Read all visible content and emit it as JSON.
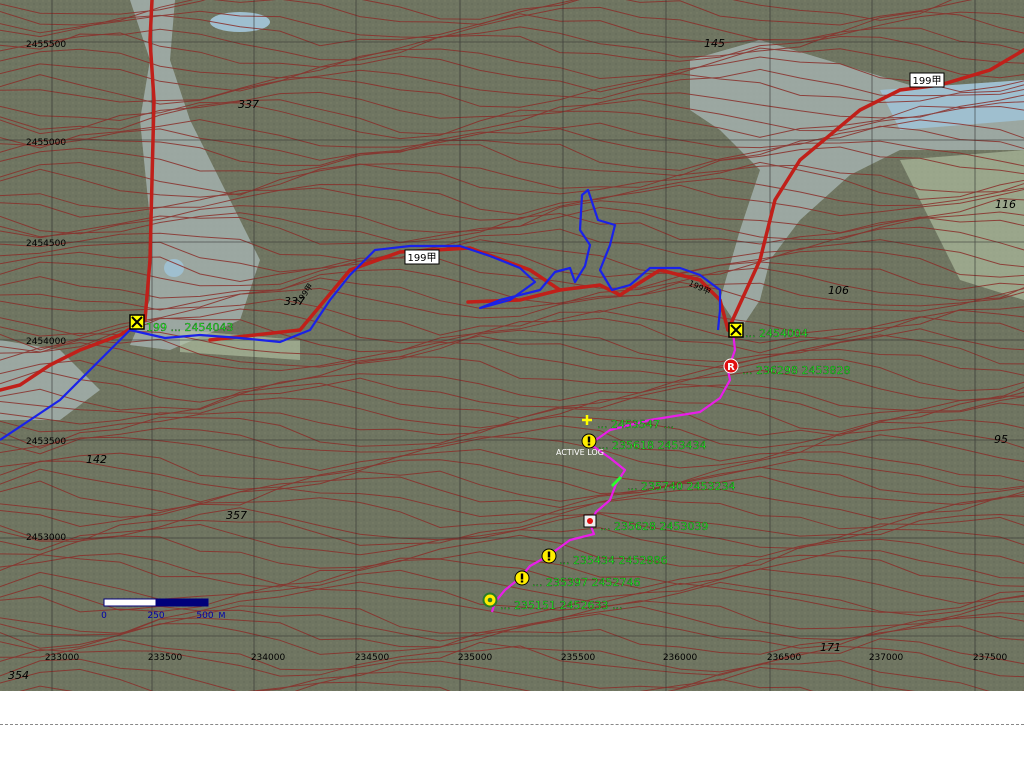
{
  "map": {
    "easting_labels": [
      "233000",
      "233500",
      "234000",
      "234500",
      "235000",
      "235500",
      "236000",
      "236500",
      "237000",
      "237500"
    ],
    "northing_labels": [
      "2455500",
      "2455000",
      "2454500",
      "2454000",
      "2453500",
      "2453000"
    ],
    "spot_heights": [
      "337",
      "337",
      "145",
      "106",
      "116",
      "95",
      "142",
      "357",
      "354",
      "171"
    ],
    "road_shield": "199甲",
    "route_code": "199甲",
    "scale_bar": {
      "ticks": [
        "0",
        "250",
        "500"
      ],
      "unit": "M"
    },
    "waypoints": [
      {
        "id": "start-x",
        "kind": "x-box",
        "label": "199 ... 2454043"
      },
      {
        "id": "end-x",
        "kind": "x-box",
        "label": "... 2454004"
      },
      {
        "id": "r-point",
        "kind": "red-r",
        "label": "... 236298 2453828"
      },
      {
        "id": "plus-point",
        "kind": "plus",
        "label": "... 2453547 ..."
      },
      {
        "id": "warn-1",
        "kind": "warning",
        "label": "... 235618 2453434"
      },
      {
        "id": "pen-point",
        "kind": "pencil",
        "label": "... 235740 2453234"
      },
      {
        "id": "target",
        "kind": "target",
        "label": "... 235628 2453039"
      },
      {
        "id": "warn-2",
        "kind": "warning",
        "label": "... 235434 2452886"
      },
      {
        "id": "warn-3",
        "kind": "warning",
        "label": "... 235397 2452746"
      },
      {
        "id": "start-point",
        "kind": "start",
        "label": "... 235151 2452633 ..."
      }
    ],
    "active_log_label": "ACTIVE LOG"
  },
  "colors": {
    "map_base": "#6f7561",
    "contour": "#8a2f2a",
    "road": "#c0201a",
    "track_blue": "#1a22e8",
    "track_magenta": "#e81ee8",
    "label_green": "#2bff2b",
    "water": "#9fbfcf"
  }
}
